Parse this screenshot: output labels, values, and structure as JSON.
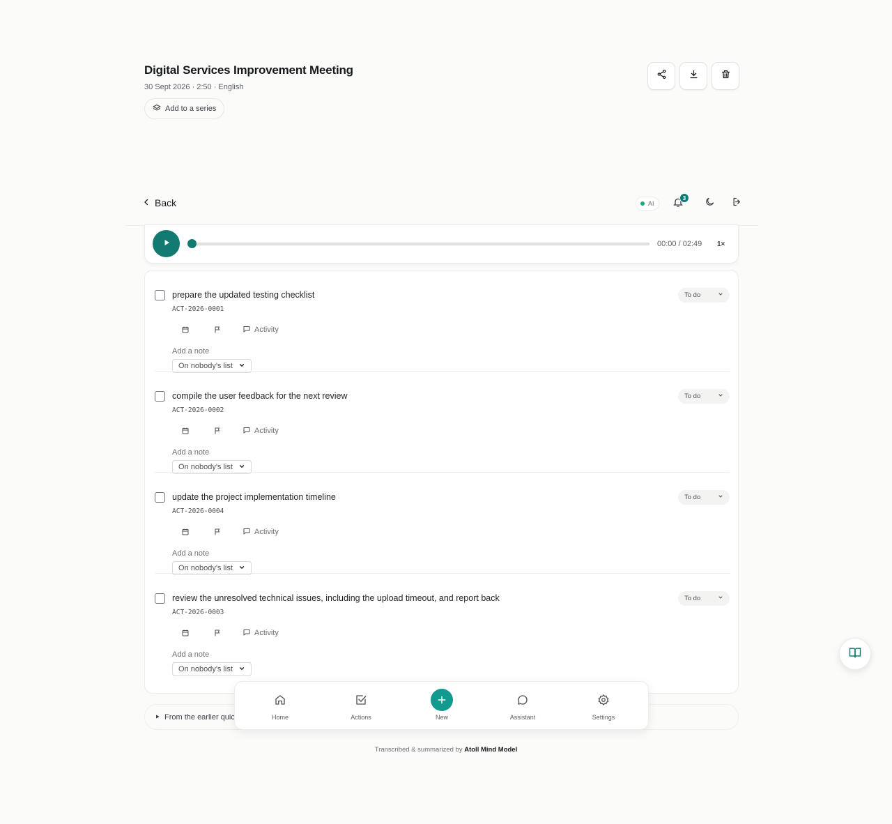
{
  "header": {
    "title": "Digital Services Improvement Meeting",
    "meta": "30 Sept 2026 · 2:50 · English",
    "add_series_label": "Add to a series",
    "buttons": [
      "share-icon",
      "download-icon",
      "trash-icon"
    ]
  },
  "nav": {
    "back_label": "Back",
    "ai_label": "AI",
    "notification_count": "3",
    "icons": [
      "bell-icon",
      "moon-icon",
      "logout-icon"
    ]
  },
  "player": {
    "time": "00:00 / 02:49",
    "speed": "1×",
    "progress": 0
  },
  "actions": [
    {
      "title": "prepare the updated testing checklist",
      "id": "ACT-2026-0001",
      "status": "To do",
      "activity_label": "Activity",
      "note_placeholder": "Add a note",
      "owner": "On nobody's list"
    },
    {
      "title": "compile the user feedback for the next review",
      "id": "ACT-2026-0002",
      "status": "To do",
      "activity_label": "Activity",
      "note_placeholder": "Add a note",
      "owner": "On nobody's list"
    },
    {
      "title": "update the project implementation timeline",
      "id": "ACT-2026-0004",
      "status": "To do",
      "activity_label": "Activity",
      "note_placeholder": "Add a note",
      "owner": "On nobody's list"
    },
    {
      "title": "review the unresolved technical issues, including the upload timeout, and report back",
      "id": "ACT-2026-0003",
      "status": "To do",
      "activity_label": "Activity",
      "note_placeholder": "Add a note",
      "owner": "On nobody's list"
    }
  ],
  "earlier_label": "From the earlier quic",
  "bottom_nav": {
    "home": "Home",
    "actions": "Actions",
    "new": "New",
    "assistant": "Assistant",
    "settings": "Settings"
  },
  "footer": {
    "prefix": "Transcribed & summarized by",
    "model": "Atoll Mind Model"
  },
  "colors": {
    "accent": "#127a71",
    "accent_bright": "#14998e",
    "status_dot": "#1fa97a"
  }
}
